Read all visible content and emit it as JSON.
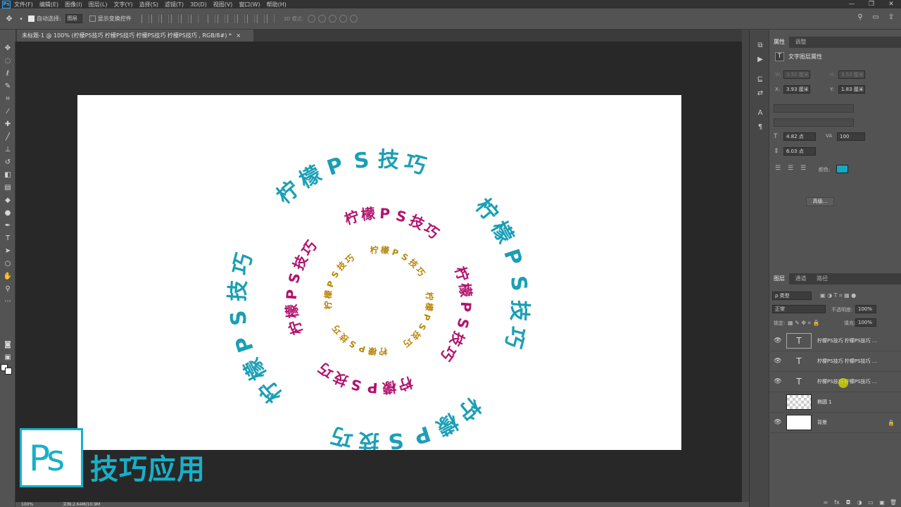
{
  "menubar": {
    "logo": "Ps",
    "items": [
      "文件(F)",
      "编辑(E)",
      "图像(I)",
      "图层(L)",
      "文字(Y)",
      "选择(S)",
      "滤镜(T)",
      "3D(D)",
      "视图(V)",
      "窗口(W)",
      "帮助(H)"
    ],
    "minimize": "—",
    "restore": "❐",
    "close": "✕"
  },
  "options": {
    "auto_select_label": "自动选择:",
    "auto_select_value": "图层",
    "show_transform_label": "显示变换控件",
    "mode_3d_label": "3D 模式:"
  },
  "document": {
    "tab_title": "未标题-1 @ 100% (柠檬PS技巧   柠檬PS技巧   柠檬PS技巧   柠檬PS技巧   , RGB/8#) *",
    "tab_close": "×"
  },
  "canvas": {
    "rings": [
      {
        "text": "柠檬PS技巧",
        "color": "#1a9fb6"
      },
      {
        "text": "柠檬PS技巧",
        "color": "#b0136e"
      },
      {
        "text": "柠檬PS技巧",
        "color": "#b8860b"
      }
    ]
  },
  "watermark": {
    "logo": "Ps",
    "text": "技巧应用"
  },
  "status": {
    "zoom": "100%",
    "doc_size": "文档:2.64M/10.9M"
  },
  "properties": {
    "tabs": [
      "属性",
      "调整"
    ],
    "title": "文字图层属性",
    "w_label": "W:",
    "w_value": "3.52 厘米",
    "h_label": "H:",
    "h_value": "3.52 厘米",
    "x_label": "X:",
    "x_value": "3.93 厘米",
    "y_label": "Y:",
    "y_value": "1.83 厘米",
    "font_size": "4.82 点",
    "tracking": "100",
    "leading": "6.03 点",
    "color_label": "颜色:",
    "color_value": "#17a8c4",
    "advanced_button": "高级..."
  },
  "layers": {
    "tabs": [
      "图层",
      "通道",
      "路径"
    ],
    "filter_label": "ρ 类型",
    "blend_mode": "正常",
    "opacity_label": "不透明度:",
    "opacity_value": "100%",
    "lock_label": "锁定:",
    "fill_label": "填充:",
    "fill_value": "100%",
    "items": [
      {
        "name": "柠檬PS技巧    柠檬PS技巧  ...",
        "thumb": "T"
      },
      {
        "name": "柠檬PS技巧    柠檬PS技巧  ...",
        "thumb": "T"
      },
      {
        "name": "柠檬PS技巧    柠檬PS技巧  ...",
        "thumb": "T"
      },
      {
        "name": "椭圆 1",
        "thumb": ""
      },
      {
        "name": "背景",
        "thumb": ""
      }
    ],
    "footer_icons": [
      "fx",
      "◘",
      "◑",
      "▭",
      "▣",
      "🗑"
    ]
  }
}
